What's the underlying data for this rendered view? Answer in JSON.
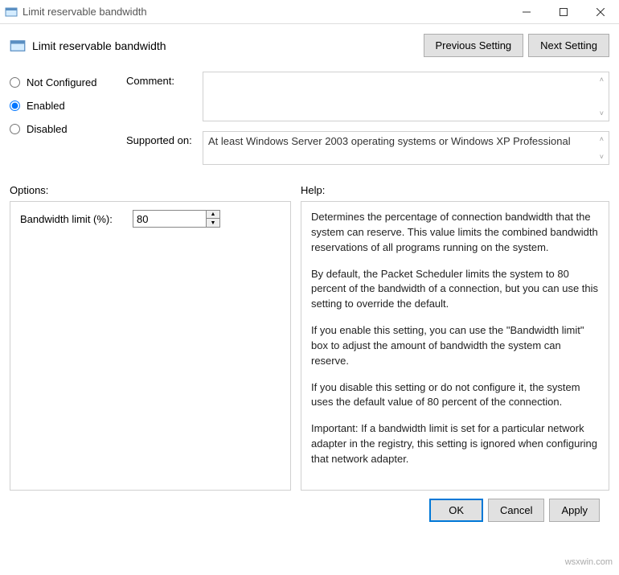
{
  "window": {
    "title": "Limit reservable bandwidth"
  },
  "header": {
    "title": "Limit reservable bandwidth",
    "prev_btn": "Previous Setting",
    "next_btn": "Next Setting"
  },
  "radios": {
    "not_configured": "Not Configured",
    "enabled": "Enabled",
    "disabled": "Disabled",
    "selected": "enabled"
  },
  "labels": {
    "comment": "Comment:",
    "supported": "Supported on:",
    "options": "Options:",
    "help": "Help:"
  },
  "supported_text": "At least Windows Server 2003 operating systems or Windows XP Professional",
  "options": {
    "bandwidth_label": "Bandwidth limit (%):",
    "bandwidth_value": "80"
  },
  "help": {
    "p1": "Determines the percentage of connection bandwidth that the system can reserve. This value limits the combined bandwidth reservations of all programs running on the system.",
    "p2": "By default, the Packet Scheduler limits the system to 80 percent of the bandwidth of a connection, but you can use this setting to override the default.",
    "p3": "If you enable this setting, you can use the \"Bandwidth limit\" box to adjust the amount of bandwidth the system can reserve.",
    "p4": "If you disable this setting or do not configure it, the system uses the default value of 80 percent of the connection.",
    "p5": "Important: If a bandwidth limit is set for a particular network adapter in the registry, this setting is ignored when configuring that network adapter."
  },
  "footer": {
    "ok": "OK",
    "cancel": "Cancel",
    "apply": "Apply"
  },
  "watermark": "wsxwin.com"
}
